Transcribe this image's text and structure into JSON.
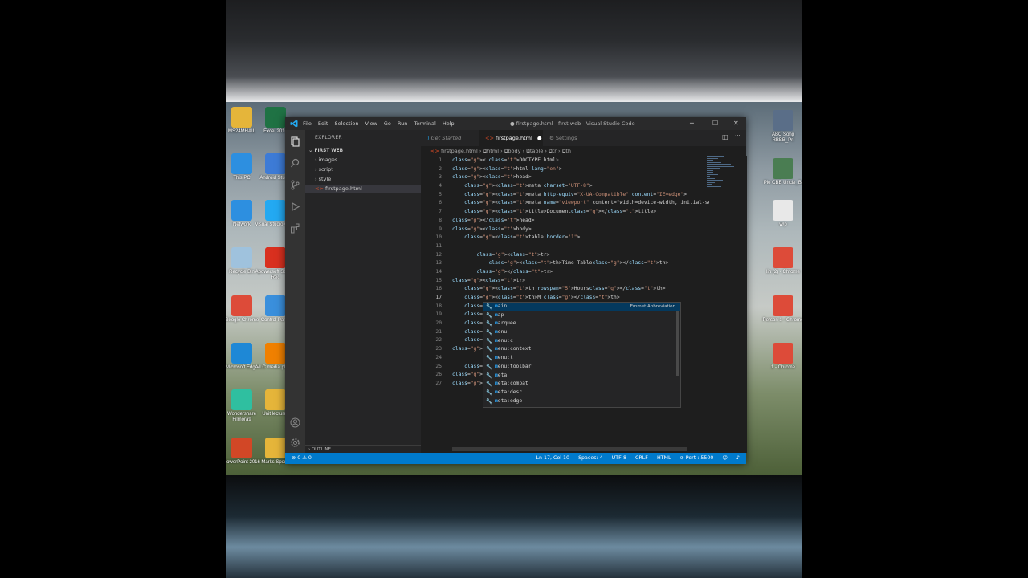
{
  "desktop": {
    "icons_left": [
      {
        "label": "MS24MHAIL",
        "color": "#e5b53a",
        "glyph": "folder-icon"
      },
      {
        "label": "This PC",
        "color": "#2d8fe0",
        "glyph": "monitor-icon"
      },
      {
        "label": "Network",
        "color": "#2d8fe0",
        "glyph": "network-icon"
      },
      {
        "label": "Recycle Bin",
        "color": "#9fc2dd",
        "glyph": "recycle-bin-icon"
      },
      {
        "label": "Google Chrome",
        "color": "#dd4b39",
        "glyph": "chrome-icon"
      },
      {
        "label": "Microsoft Edge",
        "color": "#1e88d6",
        "glyph": "edge-icon"
      },
      {
        "label": "Wondershare Filmora9",
        "color": "#2fbfa0",
        "glyph": "filmora-icon"
      },
      {
        "label": "PowerPoint 2016",
        "color": "#d24726",
        "glyph": "powerpoint-icon"
      }
    ],
    "icons_col2": [
      {
        "label": "Excel 2016",
        "color": "#1f7244",
        "glyph": "excel-icon"
      },
      {
        "label": "Android Studio",
        "color": "#3d7bd6",
        "glyph": "android-studio-icon"
      },
      {
        "label": "Visual Studio Code",
        "color": "#23a9f2",
        "glyph": "vscode-icon"
      },
      {
        "label": "Apowersoft Screen Rec",
        "color": "#d9301f",
        "glyph": "recorder-icon"
      },
      {
        "label": "Control Panel",
        "color": "#3a8fdc",
        "glyph": "control-panel-icon"
      },
      {
        "label": "VLC media player",
        "color": "#f08000",
        "glyph": "vlc-icon"
      },
      {
        "label": "Unit lectures",
        "color": "#e5b53a",
        "glyph": "folder-icon"
      },
      {
        "label": "Marks Sports",
        "color": "#e5b53a",
        "glyph": "folder-icon"
      }
    ],
    "icons_right": [
      {
        "label": "ABC Song RBBB_Pri",
        "color": "#5a6e88",
        "glyph": "video-icon"
      },
      {
        "label": "Pie CBB Uncle_Bi",
        "color": "#4a7d52",
        "glyph": "video-icon"
      },
      {
        "label": "w/p",
        "color": "#e8e8e8",
        "glyph": "file-icon"
      },
      {
        "label": "lin (2) - Chrome",
        "color": "#dd4b39",
        "glyph": "chrome-icon"
      },
      {
        "label": "Person 1 - Chrome",
        "color": "#dd4b39",
        "glyph": "chrome-icon"
      },
      {
        "label": "1 - Chrome",
        "color": "#dd4b39",
        "glyph": "chrome-icon"
      }
    ]
  },
  "window": {
    "title": "● firstpage.html - first web - Visual Studio Code",
    "menu": [
      "File",
      "Edit",
      "Selection",
      "View",
      "Go",
      "Run",
      "Terminal",
      "Help"
    ]
  },
  "sidebar": {
    "header": "EXPLORER",
    "more": "···",
    "folder": "FIRST WEB",
    "items": [
      {
        "label": "images",
        "type": "folder"
      },
      {
        "label": "script",
        "type": "folder"
      },
      {
        "label": "style",
        "type": "folder"
      },
      {
        "label": "firstpage.html",
        "type": "file"
      }
    ],
    "outline": "OUTLINE"
  },
  "tabs": [
    {
      "label": "Get Started",
      "active": false
    },
    {
      "label": "firstpage.html",
      "active": true,
      "dirty": true
    },
    {
      "label": "Settings",
      "active": false
    }
  ],
  "breadcrumbs": [
    "firstpage.html",
    "html",
    "body",
    "table",
    "tr",
    "th"
  ],
  "editor": {
    "current_line": 17,
    "lines": [
      "<!DOCTYPE html>",
      "<html lang=\"en\">",
      "<head>",
      "    <meta charset=\"UTF-8\">",
      "    <meta http-equiv=\"X-UA-Compatible\" content=\"IE=edge\">",
      "    <meta name=\"viewport\" content=\"width=device-width, initial-scale=1.0",
      "    <title>Document</title>",
      "</head>",
      "<body>",
      "    <table border=\"1\">",
      "",
      "        <tr>",
      "            <th>Time Table</th>",
      "        </tr>",
      "<tr>",
      "    <th rowspan=\"5\">Hours</th>",
      "    <th>M </th>",
      "    <th>",
      "    <th>",
      "    <th>",
      "    <th>",
      "    <th>",
      "</tr>",
      "",
      "    </table>",
      "</body>",
      "</html>"
    ]
  },
  "suggest": {
    "typed": "M",
    "detail": "Emmet Abbreviation",
    "items": [
      "main",
      "map",
      "marquee",
      "menu",
      "menu:c",
      "menu:context",
      "menu:t",
      "menu:toolbar",
      "meta",
      "meta:compat",
      "meta:desc",
      "meta:edge"
    ]
  },
  "status": {
    "problems": "⊗ 0 ⚠ 0",
    "position": "Ln 17, Col 10",
    "spaces": "Spaces: 4",
    "encoding": "UTF-8",
    "eol": "CRLF",
    "language": "HTML",
    "port": "⊘ Port : 5500"
  }
}
